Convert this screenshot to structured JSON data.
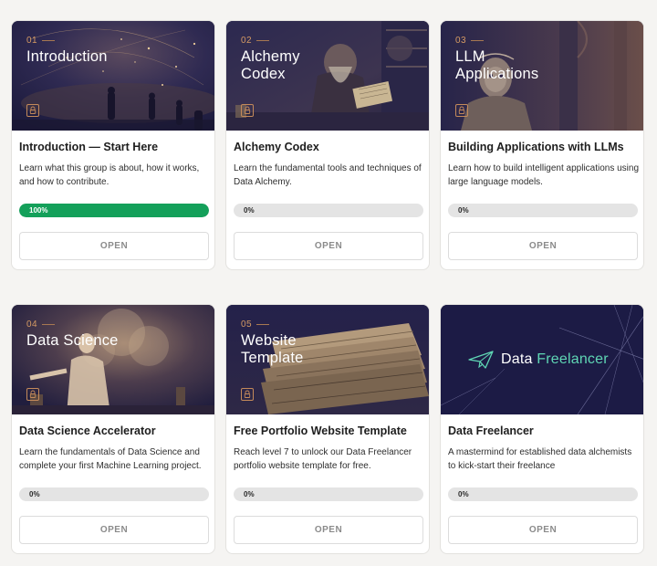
{
  "colors": {
    "accent_number": "#d59a63",
    "progress_fill": "#14a05a",
    "freelancer_accent": "#5fd6b4",
    "hero_bg": "#24224a"
  },
  "cards": [
    {
      "number": "01",
      "hero_title": "Introduction",
      "title": "Introduction — Start Here",
      "description": "Learn what this group is about, how it works, and how to contribute.",
      "progress": 100,
      "progress_label": "100%",
      "button": "OPEN",
      "icon": "lock-icon"
    },
    {
      "number": "02",
      "hero_title": "Alchemy Codex",
      "title": "Alchemy Codex",
      "description": "Learn the fundamental tools and techniques of Data Alchemy.",
      "progress": 0,
      "progress_label": "0%",
      "button": "OPEN",
      "icon": "lock-icon"
    },
    {
      "number": "03",
      "hero_title": "LLM Applications",
      "title": "Building Applications with LLMs",
      "description": "Learn how to build intelligent applications using large language models.",
      "progress": 0,
      "progress_label": "0%",
      "button": "OPEN",
      "icon": "lock-icon"
    },
    {
      "number": "04",
      "hero_title": "Data Science",
      "title": "Data Science Accelerator",
      "description": "Learn the fundamentals of Data Science and complete your first Machine Learning project.",
      "progress": 0,
      "progress_label": "0%",
      "button": "OPEN",
      "icon": "lock-icon"
    },
    {
      "number": "05",
      "hero_title": "Website Template",
      "title": "Free Portfolio Website Template",
      "description": "Reach level 7 to unlock our Data Freelancer portfolio website template for free.",
      "progress": 0,
      "progress_label": "0%",
      "button": "OPEN",
      "icon": "lock-icon"
    },
    {
      "logo_text_main": "Data",
      "logo_text_accent": "Freelancer",
      "logo_icon": "paper-plane-icon",
      "title": "Data Freelancer",
      "description": "A mastermind for established data alchemists to kick-start their freelance",
      "progress": 0,
      "progress_label": "0%",
      "button": "OPEN"
    }
  ]
}
